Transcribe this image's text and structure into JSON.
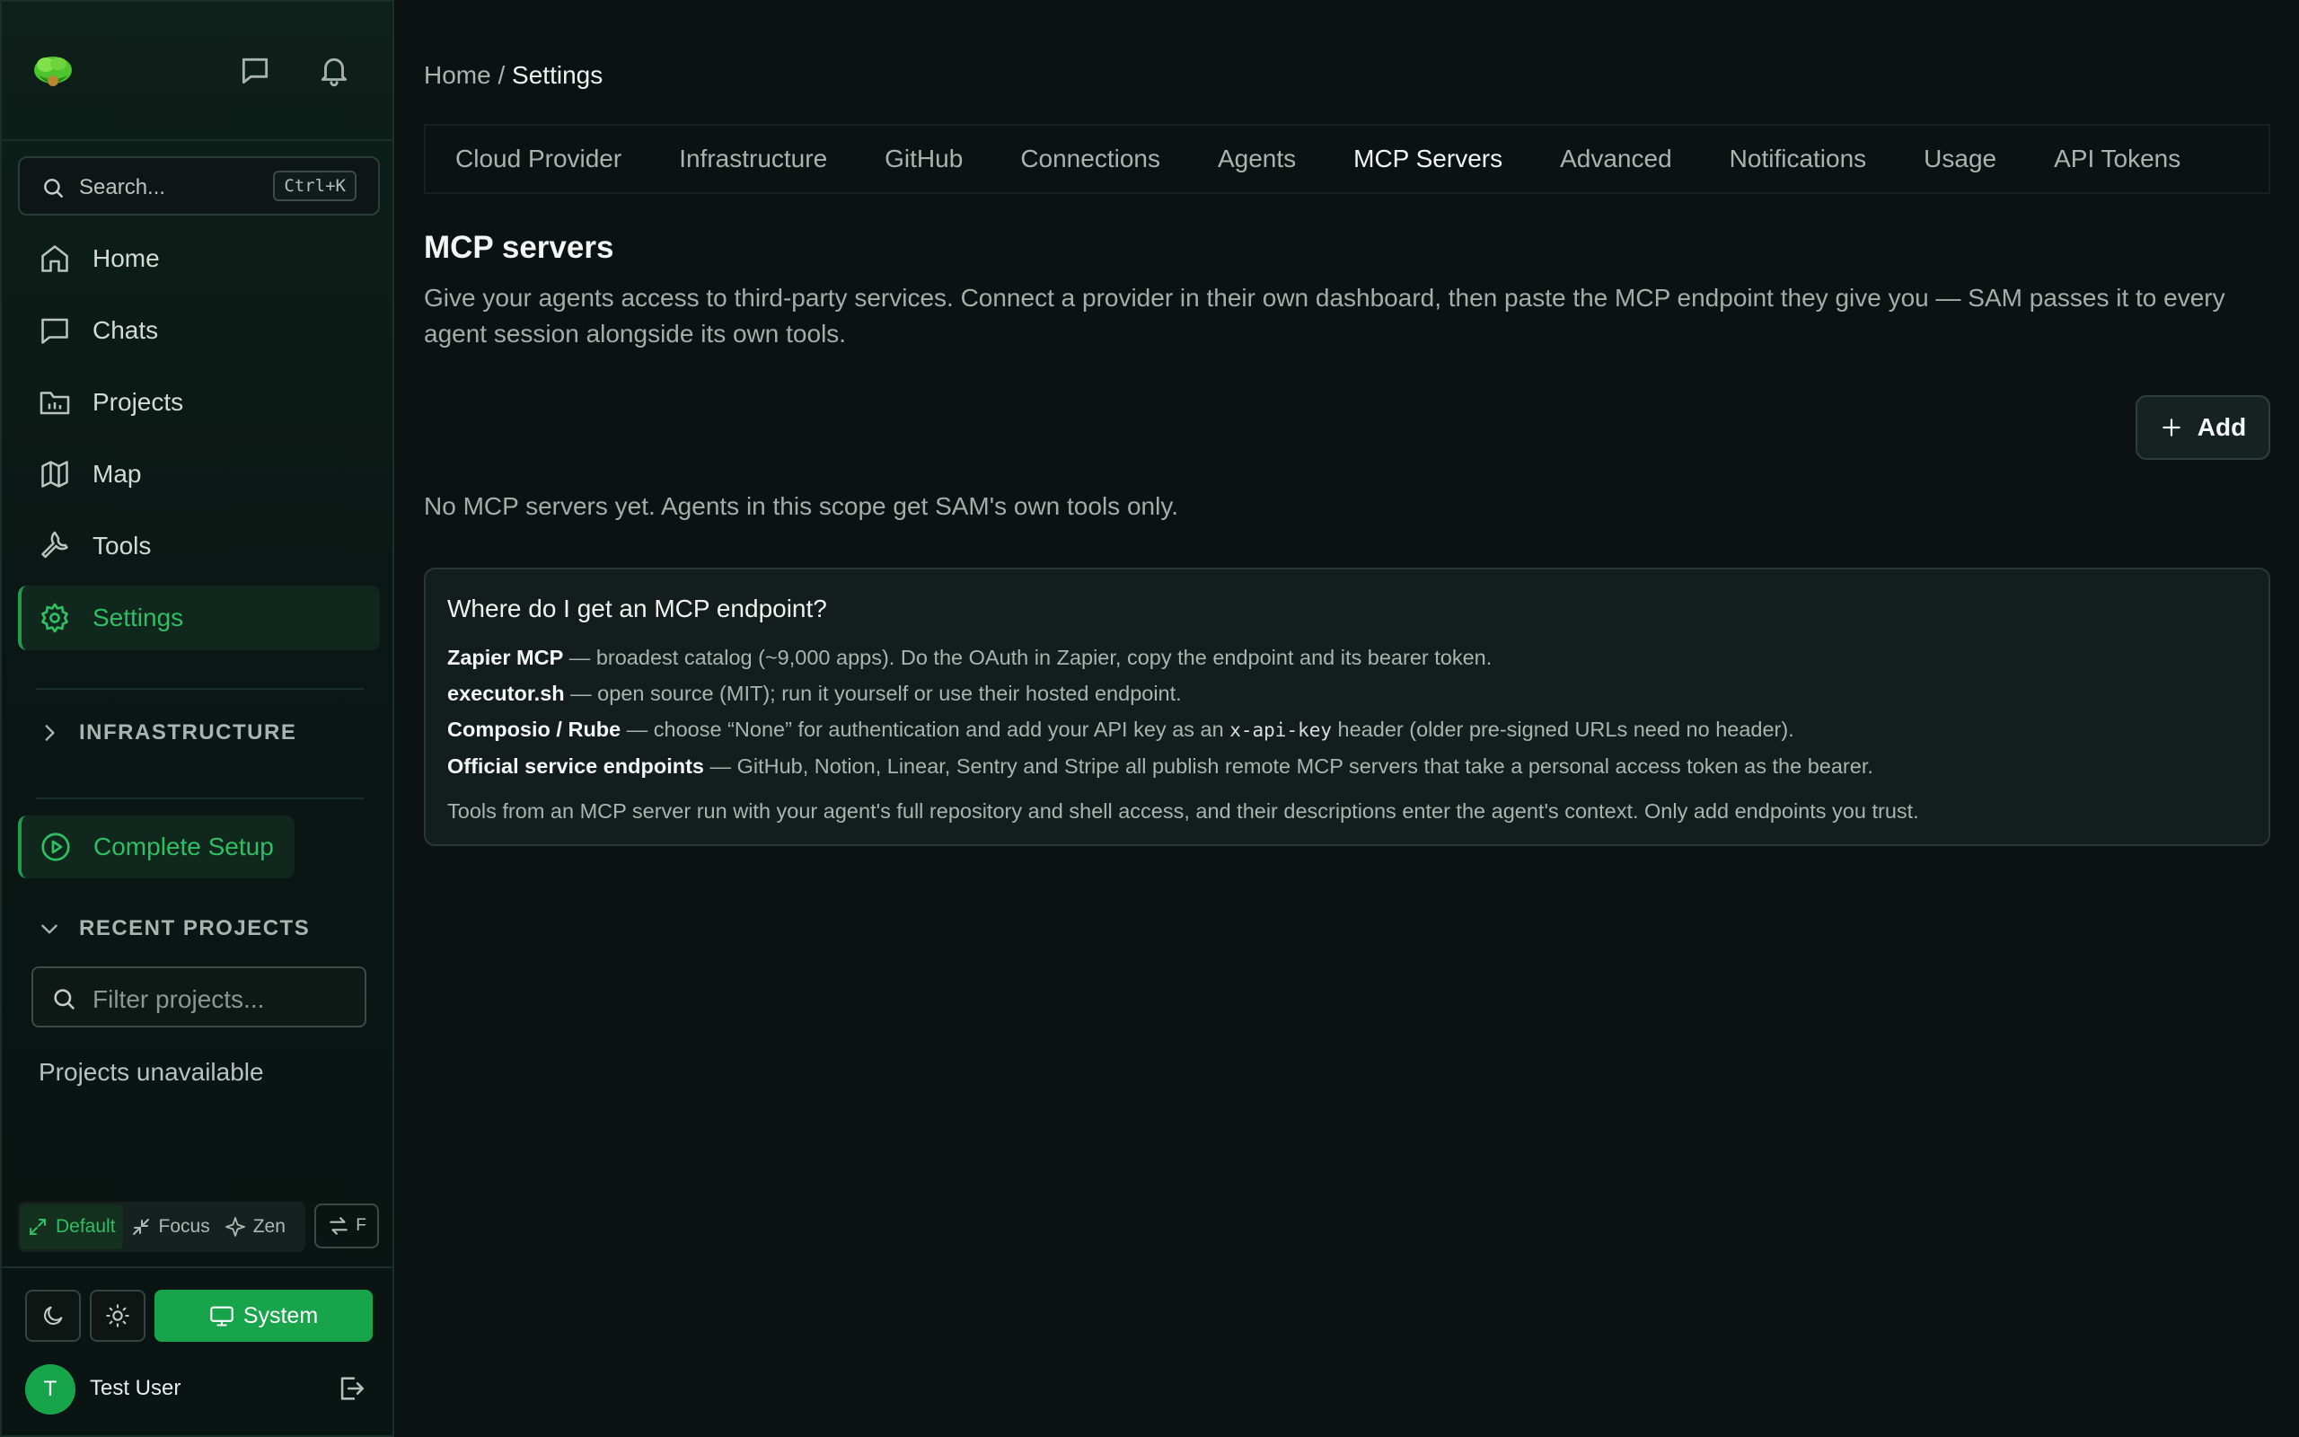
{
  "sidebar": {
    "search": {
      "placeholder": "Search...",
      "shortcut": "Ctrl+K"
    },
    "nav": [
      {
        "label": "Home",
        "icon": "home-icon"
      },
      {
        "label": "Chats",
        "icon": "chat-icon"
      },
      {
        "label": "Projects",
        "icon": "folder-icon"
      },
      {
        "label": "Map",
        "icon": "map-icon"
      },
      {
        "label": "Tools",
        "icon": "wrench-icon"
      },
      {
        "label": "Settings",
        "icon": "gear-icon",
        "active": true
      }
    ],
    "infrastructure_label": "INFRASTRUCTURE",
    "complete_setup_label": "Complete Setup",
    "recent_projects_label": "RECENT PROJECTS",
    "filter_placeholder": "Filter projects...",
    "projects_unavailable": "Projects unavailable",
    "modes": [
      {
        "label": "Default",
        "active": true
      },
      {
        "label": "Focus"
      },
      {
        "label": "Zen"
      }
    ],
    "swap_shortcut": "F",
    "theme": {
      "system_label": "System"
    },
    "user": {
      "initial": "T",
      "name": "Test User"
    }
  },
  "breadcrumb": {
    "home": "Home",
    "separator": "/",
    "current": "Settings"
  },
  "tabs": [
    {
      "label": "Cloud Provider"
    },
    {
      "label": "Infrastructure"
    },
    {
      "label": "GitHub"
    },
    {
      "label": "Connections"
    },
    {
      "label": "Agents"
    },
    {
      "label": "MCP Servers",
      "active": true
    },
    {
      "label": "Advanced"
    },
    {
      "label": "Notifications"
    },
    {
      "label": "Usage"
    },
    {
      "label": "API Tokens"
    }
  ],
  "content": {
    "title": "MCP servers",
    "description": "Give your agents access to third-party services. Connect a provider in their own dashboard, then paste the MCP endpoint they give you — SAM passes it to every agent session alongside its own tools.",
    "add_label": "Add",
    "empty_message": "No MCP servers yet. Agents in this scope get SAM's own tools only.",
    "info": {
      "title": "Where do I get an MCP endpoint?",
      "lines": [
        {
          "name": "Zapier MCP",
          "text": " — broadest catalog (~9,000 apps). Do the OAuth in Zapier, copy the endpoint and its bearer token."
        },
        {
          "name": "executor.sh",
          "text": " — open source (MIT); run it yourself or use their hosted endpoint."
        },
        {
          "name": "Composio / Rube",
          "text_before": " — choose “None” for authentication and add your API key as an ",
          "code": "x-api-key",
          "text_after": " header (older pre-signed URLs need no header)."
        },
        {
          "name": "Official service endpoints",
          "text": " — GitHub, Notion, Linear, Sentry and Stripe all publish remote MCP servers that take a personal access token as the bearer."
        }
      ],
      "footer": "Tools from an MCP server run with your agent's full repository and shell access, and their descriptions enter the agent's context. Only add endpoints you trust."
    }
  },
  "colors": {
    "accent": "#17a44a",
    "accent_text": "#2fbf62",
    "background": "#0b1211"
  }
}
